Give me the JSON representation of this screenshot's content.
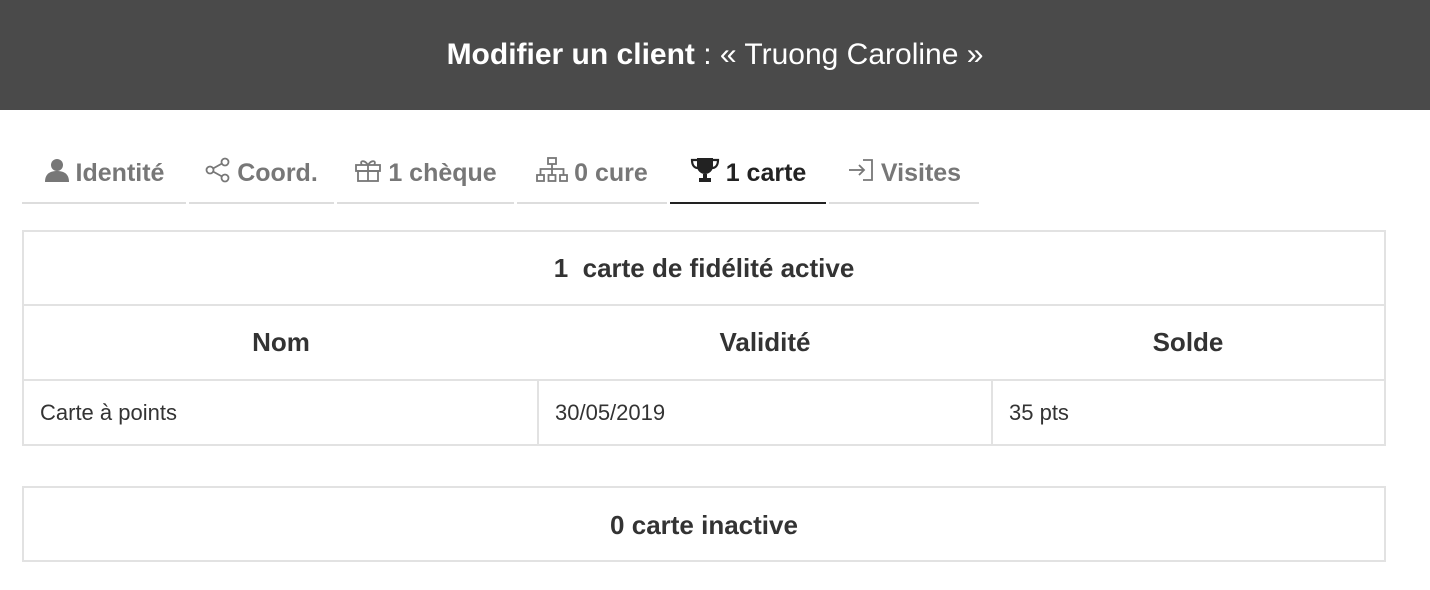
{
  "header": {
    "title_strong": "Modifier un client",
    "title_rest": " : « Truong Caroline »"
  },
  "tabs": [
    {
      "label": "Identité",
      "icon": "user-icon"
    },
    {
      "label": "Coord.",
      "icon": "share-icon"
    },
    {
      "label": "1 chèque",
      "icon": "gift-icon"
    },
    {
      "label": "0 cure",
      "icon": "sitemap-icon"
    },
    {
      "label": "1 carte",
      "icon": "trophy-icon",
      "active": true
    },
    {
      "label": "Visites",
      "icon": "sign-in-icon"
    }
  ],
  "active_cards": {
    "title": "1  carte de fidélité active",
    "columns": [
      "Nom",
      "Validité",
      "Solde"
    ],
    "rows": [
      {
        "nom": "Carte à points",
        "validite": "30/05/2019",
        "solde": "35 pts"
      }
    ]
  },
  "inactive_cards": {
    "title": "0 carte inactive"
  },
  "colors": {
    "header_bg": "#4a4a4a",
    "active_tab": "#222222",
    "inactive_tab": "#777777",
    "border": "#e2e2e2"
  }
}
